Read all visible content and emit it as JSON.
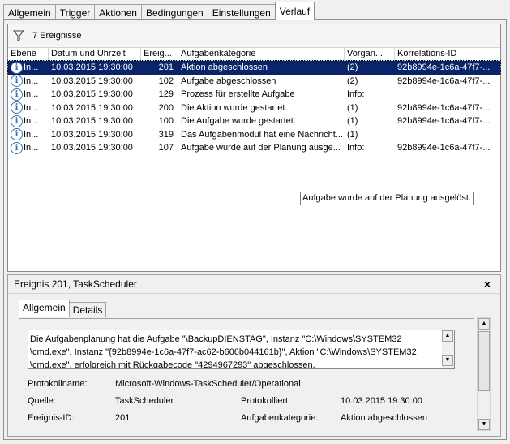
{
  "tabs": [
    "Allgemein",
    "Trigger",
    "Aktionen",
    "Bedingungen",
    "Einstellungen",
    "Verlauf"
  ],
  "filter": {
    "text": "7 Ereignisse"
  },
  "columns": [
    "Ebene",
    "Datum und Uhrzeit",
    "Ereig...",
    "Aufgabenkategorie",
    "Vorgan...",
    "Korrelations-ID"
  ],
  "rows": [
    {
      "level": "In...",
      "date": "10.03.2015 19:30:00",
      "id": "201",
      "category": "Aktion abgeschlossen",
      "op": "(2)",
      "corr": "92b8994e-1c6a-47f7-..."
    },
    {
      "level": "In...",
      "date": "10.03.2015 19:30:00",
      "id": "102",
      "category": "Aufgabe abgeschlossen",
      "op": "(2)",
      "corr": "92b8994e-1c6a-47f7-..."
    },
    {
      "level": "In...",
      "date": "10.03.2015 19:30:00",
      "id": "129",
      "category": "Prozess für erstellte Aufgabe",
      "op": "Info:",
      "corr": ""
    },
    {
      "level": "In...",
      "date": "10.03.2015 19:30:00",
      "id": "200",
      "category": "Die Aktion wurde gestartet.",
      "op": "(1)",
      "corr": "92b8994e-1c6a-47f7-..."
    },
    {
      "level": "In...",
      "date": "10.03.2015 19:30:00",
      "id": "100",
      "category": "Die Aufgabe wurde gestartet.",
      "op": "(1)",
      "corr": "92b8994e-1c6a-47f7-..."
    },
    {
      "level": "In...",
      "date": "10.03.2015 19:30:00",
      "id": "319",
      "category": "Das Aufgabenmodul hat eine Nachricht...",
      "op": "(1)",
      "corr": ""
    },
    {
      "level": "In...",
      "date": "10.03.2015 19:30:00",
      "id": "107",
      "category": "Aufgabe wurde auf der Planung ausge...",
      "op": "Info:",
      "corr": "92b8994e-1c6a-47f7-..."
    }
  ],
  "tooltip": "Aufgabe wurde auf der Planung ausgelöst.",
  "detail": {
    "title": "Ereignis 201, TaskScheduler",
    "close": "×",
    "tabs": [
      "Allgemein",
      "Details"
    ],
    "message_lines": [
      "Die Aufgabenplanung hat die Aufgabe \"\\BackupDIENSTAG\", Instanz \"C:\\Windows\\SYSTEM32",
      "\\cmd.exe\", Instanz \"{92b8994e-1c6a-47f7-ac62-b606b044161b}\", Aktion \"C:\\Windows\\SYSTEM32",
      "\\cmd.exe\", erfolgreich mit Rückgabecode \"4294967293\" abgeschlossen."
    ],
    "protokollname_label": "Protokollname:",
    "protokollname_value": "Microsoft-Windows-TaskScheduler/Operational",
    "quelle_label": "Quelle:",
    "quelle_value": "TaskScheduler",
    "protokolliert_label": "Protokolliert:",
    "protokolliert_value": "10.03.2015 19:30:00",
    "ereignisid_label": "Ereignis-ID:",
    "ereignisid_value": "201",
    "kategorie_label": "Aufgabenkategorie:",
    "kategorie_value": "Aktion abgeschlossen"
  },
  "colors": {
    "selection": "#0a246a",
    "icon_blue": "#3a6fb0"
  }
}
